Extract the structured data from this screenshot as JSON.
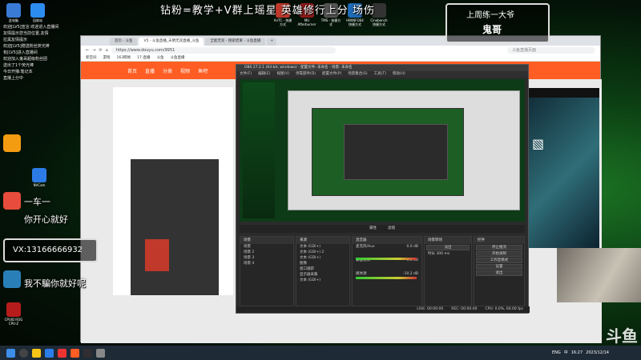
{
  "overlay": {
    "title": "钻粉=教学+V群上瑶星 英雄修行上分 场伤",
    "logo_line1": "上周练一大爷",
    "logo_line2": "鬼哥",
    "vx": "VX:13166666932",
    "ov_line1": "一车一",
    "ov_line2": "你开心就好",
    "ov_line3": "我不騙你就好呢",
    "watermark": "斗鱼"
  },
  "desktop_icons": [
    {
      "label": "此电脑",
      "color": "#3a7bd5"
    },
    {
      "label": "回收站",
      "color": "#2d8cf0"
    },
    {
      "label": "AirTC - 快捷方式",
      "color": "#c0392b"
    },
    {
      "label": "MU Afterburner",
      "color": "#8e1b1b"
    },
    {
      "label": "TMS - 快捷方式",
      "color": "#555"
    },
    {
      "label": "HWINFO64 快捷方式",
      "color": "#1e6bb8"
    },
    {
      "label": "Cinebench 快捷方式",
      "color": "#333"
    },
    {
      "label": "CPUID ROG CPU-Z",
      "color": "#b71c1c"
    },
    {
      "label": "NVCam",
      "color": "#2c7be5"
    }
  ],
  "chat": [
    "欢迎[LV5]宣言:欢迎进入直播间",
    "友情提示您当前位置,友情",
    "拉黑友情提示",
    "欢迎[LV5]赠送粉丝荧光棒",
    "有[LV5]进入直播间",
    "欢迎加入鬼哥超级粉丝团",
    "送出了1个荧光棒",
    "今日开播:笔记本",
    "直播上分中"
  ],
  "browser": {
    "tabs": [
      "首页 - 斗鱼",
      "V5 - 斗鱼直播_天明无双直播_斗鱼",
      "全能无双 - 搜索结果 - 斗鱼直播"
    ],
    "address": "https://www.douyu.com/9951",
    "search_placeholder": "斗鱼直播页面",
    "bookmarks": [
      "新空间",
      "游戏",
      "163网易",
      "17-直播",
      "斗鱼",
      "斗鱼直播"
    ],
    "site_nav": [
      "首页",
      "直播",
      "分类",
      "视频",
      "鱼吧"
    ]
  },
  "obs": {
    "title": "OBS 27.2.1 (64-bit, windows) - 配置文件: 未命名 - 场景: 未命名",
    "menu": [
      "文件(F)",
      "编辑(E)",
      "视图(V)",
      "停靠部件(D)",
      "配置文件(P)",
      "场景集合(S)",
      "工具(T)",
      "帮助(H)"
    ],
    "toolbar": [
      "属性",
      "滤镜"
    ],
    "docks": {
      "scenes": {
        "title": "场景",
        "items": [
          "场景",
          "场景 2",
          "场景 3",
          "场景 4"
        ]
      },
      "sources": {
        "title": "来源",
        "items": [
          "文本 (GDI+)",
          "文本 (GDI+) 2",
          "文本 (GDI+)",
          "图像",
          "窗口捕获",
          "显示器采集",
          "文本 (GDI+)"
        ]
      },
      "mixer": {
        "title": "混音器",
        "items": [
          {
            "label": "麦克风/Aux",
            "db": "0.0 dB"
          },
          {
            "label": "桌面音频",
            "db": "0.0 dB"
          },
          {
            "label": "媒体源",
            "db": "-10.2 dB"
          }
        ]
      },
      "transitions": {
        "title": "场景转场",
        "type": "淡出",
        "duration_label": "时长",
        "duration": "300 ms"
      },
      "controls": {
        "title": "控件",
        "buttons": [
          "停止推流",
          "开始录制",
          "工作室模式",
          "设置",
          "退出"
        ]
      }
    },
    "status": [
      "LIVE: 00:00:00",
      "REC: 00:00:00",
      "CPU: 0.0%, 60.00 fps"
    ]
  },
  "taskbar": {
    "time": "16:27",
    "date": "2023/12/14",
    "tray": [
      "ENG",
      "中"
    ]
  },
  "colors": {
    "accent_orange": "#ff5d23",
    "obs_bg": "#2b2b2b",
    "desktop_green": "#1d7a26"
  }
}
